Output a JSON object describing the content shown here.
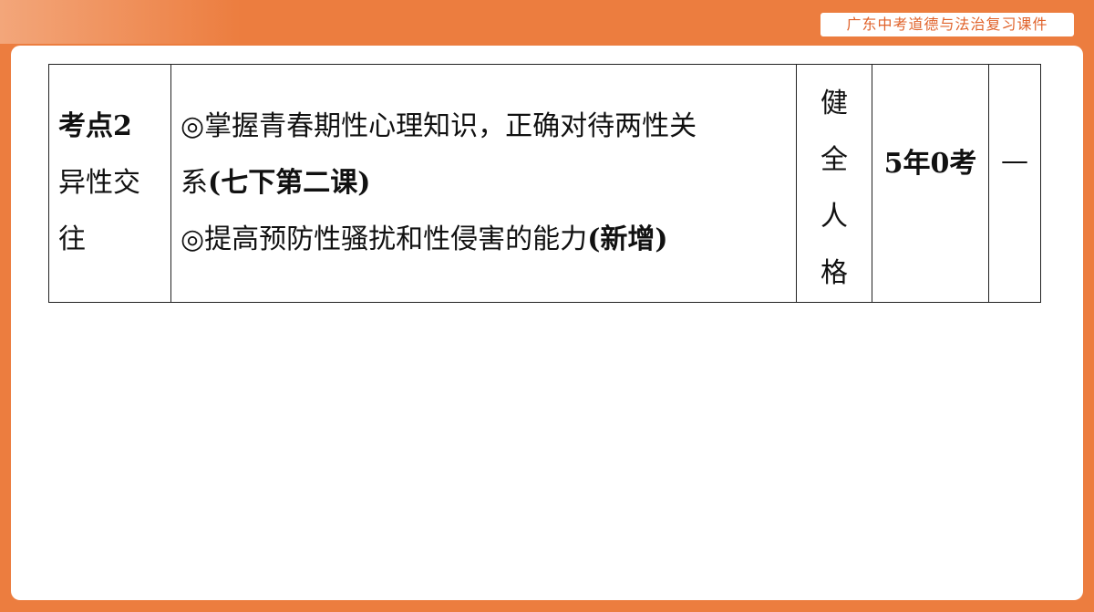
{
  "header": {
    "course_label": "广东中考道德与法治复习课件"
  },
  "table": {
    "row": {
      "topic_label": "考点2",
      "topic_title_line1": "异性交",
      "topic_title_line2": "往",
      "req_line1": "◎掌握青春期性心理知识，正确对待两性关",
      "req_line2_plain": "系",
      "req_line2_bold": "(七下第二课)",
      "req_line3_plain": "◎提高预防性骚扰和性侵害的能力",
      "req_line3_bold": "(新增)",
      "theme_chars": [
        "健",
        "全",
        "人",
        "格"
      ],
      "exam_count": "5年0考",
      "note": "—"
    }
  }
}
